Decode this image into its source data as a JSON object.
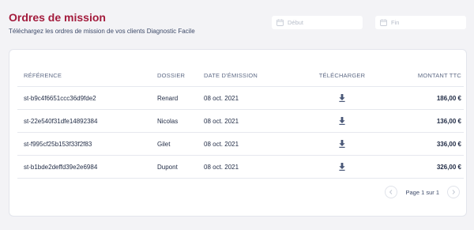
{
  "header": {
    "title": "Ordres de mission",
    "subtitle": "Téléchargez les ordres de mission de vos clients Diagnostic Facile",
    "start_placeholder": "Début",
    "end_placeholder": "Fin",
    "icons": {
      "date": "calendar-icon"
    }
  },
  "table": {
    "columns": {
      "reference": "RÉFÉRENCE",
      "dossier": "DOSSIER",
      "date": "DATE D'ÉMISSION",
      "download": "TÉLÉCHARGER",
      "amount": "MONTANT TTC"
    },
    "rows": [
      {
        "reference": "st-b9c4f6651ccc36d9fde2",
        "dossier": "Renard",
        "date": "08 oct. 2021",
        "amount": "186,00 €"
      },
      {
        "reference": "st-22e540f31dfe14892384",
        "dossier": "Nicolas",
        "date": "08 oct. 2021",
        "amount": "136,00 €"
      },
      {
        "reference": "st-f995cf25b153f33f2f83",
        "dossier": "Gilet",
        "date": "08 oct. 2021",
        "amount": "336,00 €"
      },
      {
        "reference": "st-b1bde2deffd39e2e6984",
        "dossier": "Dupont",
        "date": "08 oct. 2021",
        "amount": "326,00 €"
      }
    ],
    "row_icon": "download-icon"
  },
  "pagination": {
    "label": "Page 1 sur 1",
    "icons": {
      "prev": "chevron-left-icon",
      "next": "chevron-right-icon"
    }
  },
  "colors": {
    "title": "#a31b3c",
    "text": "#1f2a44",
    "muted": "#5e6a85",
    "background": "#f3f3f6",
    "icon": "#4a5878"
  }
}
